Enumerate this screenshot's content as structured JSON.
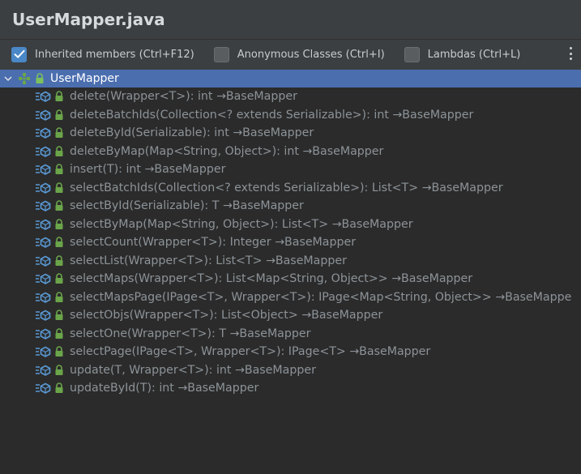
{
  "window": {
    "title": "UserMapper.java"
  },
  "toolbar": {
    "inherited_label": "Inherited members (Ctrl+F12)",
    "inherited_checked": true,
    "anonymous_label": "Anonymous Classes (Ctrl+I)",
    "anonymous_checked": false,
    "lambdas_label": "Lambdas (Ctrl+L)",
    "lambdas_checked": false,
    "more_icon": "kebab-menu-icon"
  },
  "tree": {
    "root": {
      "label": "UserMapper",
      "icon": "interface-icon",
      "expanded": true,
      "selected": true
    },
    "members": [
      {
        "signature": "delete(Wrapper<T>): int →BaseMapper"
      },
      {
        "signature": "deleteBatchIds(Collection<? extends Serializable>): int →BaseMapper"
      },
      {
        "signature": "deleteById(Serializable): int →BaseMapper"
      },
      {
        "signature": "deleteByMap(Map<String, Object>): int →BaseMapper"
      },
      {
        "signature": "insert(T): int →BaseMapper"
      },
      {
        "signature": "selectBatchIds(Collection<? extends Serializable>): List<T> →BaseMapper"
      },
      {
        "signature": "selectById(Serializable): T →BaseMapper"
      },
      {
        "signature": "selectByMap(Map<String, Object>): List<T> →BaseMapper"
      },
      {
        "signature": "selectCount(Wrapper<T>): Integer →BaseMapper"
      },
      {
        "signature": "selectList(Wrapper<T>): List<T> →BaseMapper"
      },
      {
        "signature": "selectMaps(Wrapper<T>): List<Map<String, Object>> →BaseMapper"
      },
      {
        "signature": "selectMapsPage(IPage<T>, Wrapper<T>): IPage<Map<String, Object>> →BaseMappe"
      },
      {
        "signature": "selectObjs(Wrapper<T>): List<Object> →BaseMapper"
      },
      {
        "signature": "selectOne(Wrapper<T>): T →BaseMapper"
      },
      {
        "signature": "selectPage(IPage<T>, Wrapper<T>): IPage<T> →BaseMapper"
      },
      {
        "signature": "update(T, Wrapper<T>): int →BaseMapper"
      },
      {
        "signature": "updateById(T): int →BaseMapper"
      }
    ]
  },
  "colors": {
    "selection": "#4b6eaf",
    "checkbox_on": "#4a88c7",
    "lock_green": "#6ba54a",
    "method_blue": "#5a9ad6"
  }
}
